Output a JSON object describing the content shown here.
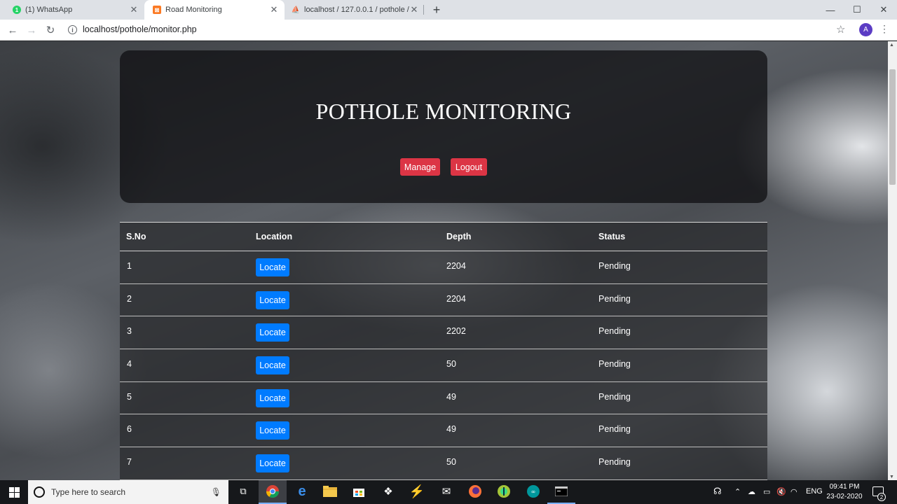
{
  "browser": {
    "tabs": [
      {
        "label": "(1) WhatsApp",
        "icon": "whatsapp-icon",
        "icon_color": "#25d366",
        "active": false
      },
      {
        "label": "Road Monitoring",
        "icon": "xampp-icon",
        "icon_color": "#fb7a24",
        "active": true
      },
      {
        "label": "localhost / 127.0.0.1 / pothole / s",
        "icon": "phpmyadmin-icon",
        "icon_color": "#f89c0e",
        "active": false
      }
    ],
    "new_tab": "+",
    "url": "localhost/pothole/monitor.php",
    "profile_initial": "A"
  },
  "page": {
    "title": "POTHOLE MONITORING",
    "buttons": {
      "manage": "Manage",
      "logout": "Logout"
    },
    "button_color": "#dc3545",
    "table": {
      "headers": [
        "S.No",
        "Location",
        "Depth",
        "Status"
      ],
      "locate_label": "Locate",
      "locate_color": "#007bff",
      "rows": [
        {
          "sno": "1",
          "depth": "2204",
          "status": "Pending"
        },
        {
          "sno": "2",
          "depth": "2204",
          "status": "Pending"
        },
        {
          "sno": "3",
          "depth": "2202",
          "status": "Pending"
        },
        {
          "sno": "4",
          "depth": "50",
          "status": "Pending"
        },
        {
          "sno": "5",
          "depth": "49",
          "status": "Pending"
        },
        {
          "sno": "6",
          "depth": "49",
          "status": "Pending"
        },
        {
          "sno": "7",
          "depth": "50",
          "status": "Pending"
        }
      ]
    }
  },
  "taskbar": {
    "search_placeholder": "Type here to search",
    "language": "ENG",
    "time": "09:41 PM",
    "date": "23-02-2020",
    "notification_count": "2"
  }
}
